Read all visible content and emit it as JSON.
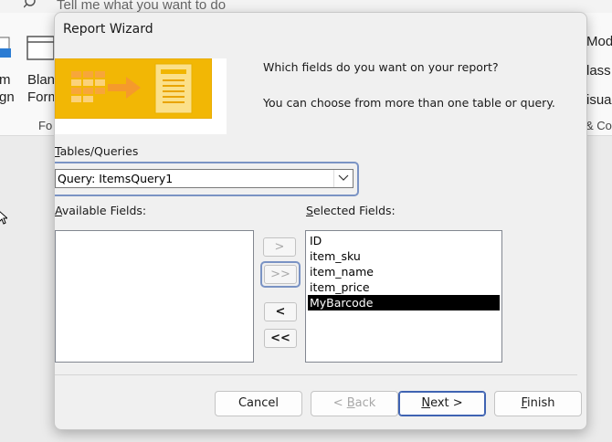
{
  "background": {
    "search_text": "Tell me what you want to do",
    "ribbon_left_lines": [
      "m",
      "gn"
    ],
    "ribbon_left2_lines": [
      "Blan",
      "Form"
    ],
    "ribbon_group_left": "Fo",
    "ribbon_right_lines": [
      "Modu",
      "lass",
      "isual"
    ],
    "ribbon_group_right": "& Co"
  },
  "dialog": {
    "title": "Report Wizard",
    "prompt_line1": "Which fields do you want on your report?",
    "prompt_line2": "You can choose from more than one table or query.",
    "tables_label_u": "T",
    "tables_label_rest": "ables/Queries",
    "combo_value": "Query: ItemsQuery1",
    "available_label_u": "A",
    "available_label_rest": "vailable Fields:",
    "available_fields": [],
    "selected_label_u": "S",
    "selected_label_rest": "elected Fields:",
    "selected_fields": [
      "ID",
      "item_sku",
      "item_name",
      "item_price",
      "MyBarcode"
    ],
    "selected_highlight_index": 4,
    "move_buttons": {
      "add_one": ">",
      "add_all": ">>",
      "remove_one": "<",
      "remove_all": "<<"
    },
    "buttons": {
      "cancel": "Cancel",
      "back_prefix": "< ",
      "back_u": "B",
      "back_rest": "ack",
      "next_u": "N",
      "next_rest": "ext >",
      "finish_u": "F",
      "finish_rest": "inish"
    }
  }
}
